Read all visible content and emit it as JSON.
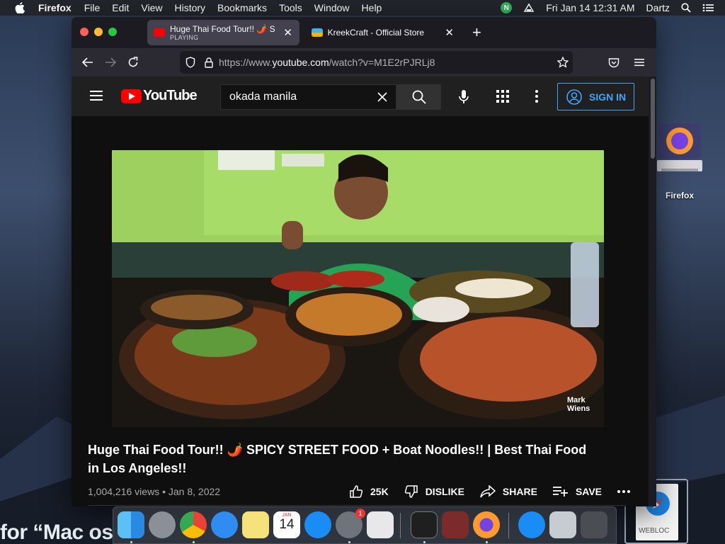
{
  "menubar": {
    "app_name": "Firefox",
    "menus": [
      "File",
      "Edit",
      "View",
      "History",
      "Bookmarks",
      "Tools",
      "Window",
      "Help"
    ],
    "status_n": "N",
    "clock": "Fri Jan 14  12:31 AM",
    "user": "Dartz"
  },
  "browser": {
    "tabs": [
      {
        "title": "Huge Thai Food Tour!! 🌶️ SPICY",
        "subtitle": "PLAYING"
      },
      {
        "title": "KreekCraft - Official Store"
      }
    ],
    "url_prefix": "https://www.",
    "url_domain": "youtube.com",
    "url_path": "/watch?v=M1E2rPJRLj8"
  },
  "youtube": {
    "logo_text": "YouTube",
    "search_value": "okada manila",
    "signin_label": "SIGN IN",
    "video_title": "Huge Thai Food Tour!! 🌶️ SPICY STREET FOOD + Boat Noodles!! | Best Thai Food in Los Angeles!!",
    "views": "1,004,216 views",
    "date": "Jan 8, 2022",
    "meta_sep": " • ",
    "likes": "25K",
    "dislike_label": "DISLIKE",
    "share_label": "SHARE",
    "save_label": "SAVE",
    "watermark": "Mark Wiens"
  },
  "desktop": {
    "firefox_label": "Firefox",
    "webloc_label": "WEBLOC",
    "bg_text": "for “Mac os"
  },
  "dock": {
    "calendar_month": "JAN",
    "calendar_day": "14",
    "badge": "1"
  },
  "colors": {
    "yt_red": "#ff0000",
    "signin_blue": "#3ea6ff",
    "page_bg": "#0f0f0f"
  }
}
